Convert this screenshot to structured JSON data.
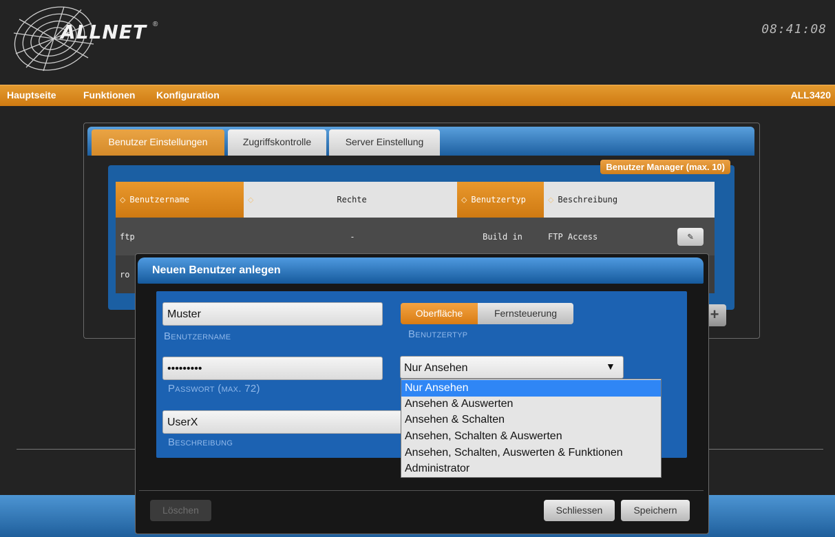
{
  "header": {
    "logo_text": "ALLNET",
    "logo_mark": "®",
    "clock": "08:41:08"
  },
  "nav": {
    "items": [
      "Hauptseite",
      "Funktionen",
      "Konfiguration"
    ],
    "model": "ALL3420"
  },
  "tabs": [
    "Benutzer Einstellungen",
    "Zugriffskontrolle",
    "Server Einstellung"
  ],
  "user_manager": {
    "label": "Benutzer Manager (max. 10)",
    "columns": [
      "Benutzername",
      "Rechte",
      "Benutzertyp",
      "Beschreibung"
    ],
    "rows": [
      {
        "name": "ftp",
        "rights": "-",
        "type": "Build in",
        "description": "FTP Access"
      },
      {
        "name": "ro",
        "rights": "",
        "type": "",
        "description": ""
      }
    ],
    "add_symbol": "+"
  },
  "modal": {
    "title": "Neuen Benutzer anlegen",
    "username_value": "Muster",
    "username_caption": "Benutzername",
    "usertype_caption": "Benutzertyp",
    "usertype_options": [
      "Oberfläche",
      "Fernsteuerung"
    ],
    "usertype_selected": "Oberfläche",
    "password_value": "•••••••••",
    "password_caption": "Passwort (max. 72)",
    "description_value": "UserX",
    "description_caption": "Beschreibung",
    "rights_select": {
      "value": "Nur Ansehen",
      "options": [
        "Nur Ansehen",
        "Ansehen & Auswerten",
        "Ansehen & Schalten",
        "Ansehen, Schalten & Auswerten",
        "Ansehen, Schalten, Auswerten & Funktionen",
        "Administrator"
      ]
    },
    "buttons": {
      "delete": "Löschen",
      "close": "Schliessen",
      "save": "Speichern"
    }
  },
  "colors": {
    "accent_orange": "#d98a28",
    "accent_blue": "#1c62b2",
    "dropdown_highlight": "#2f86f5"
  }
}
